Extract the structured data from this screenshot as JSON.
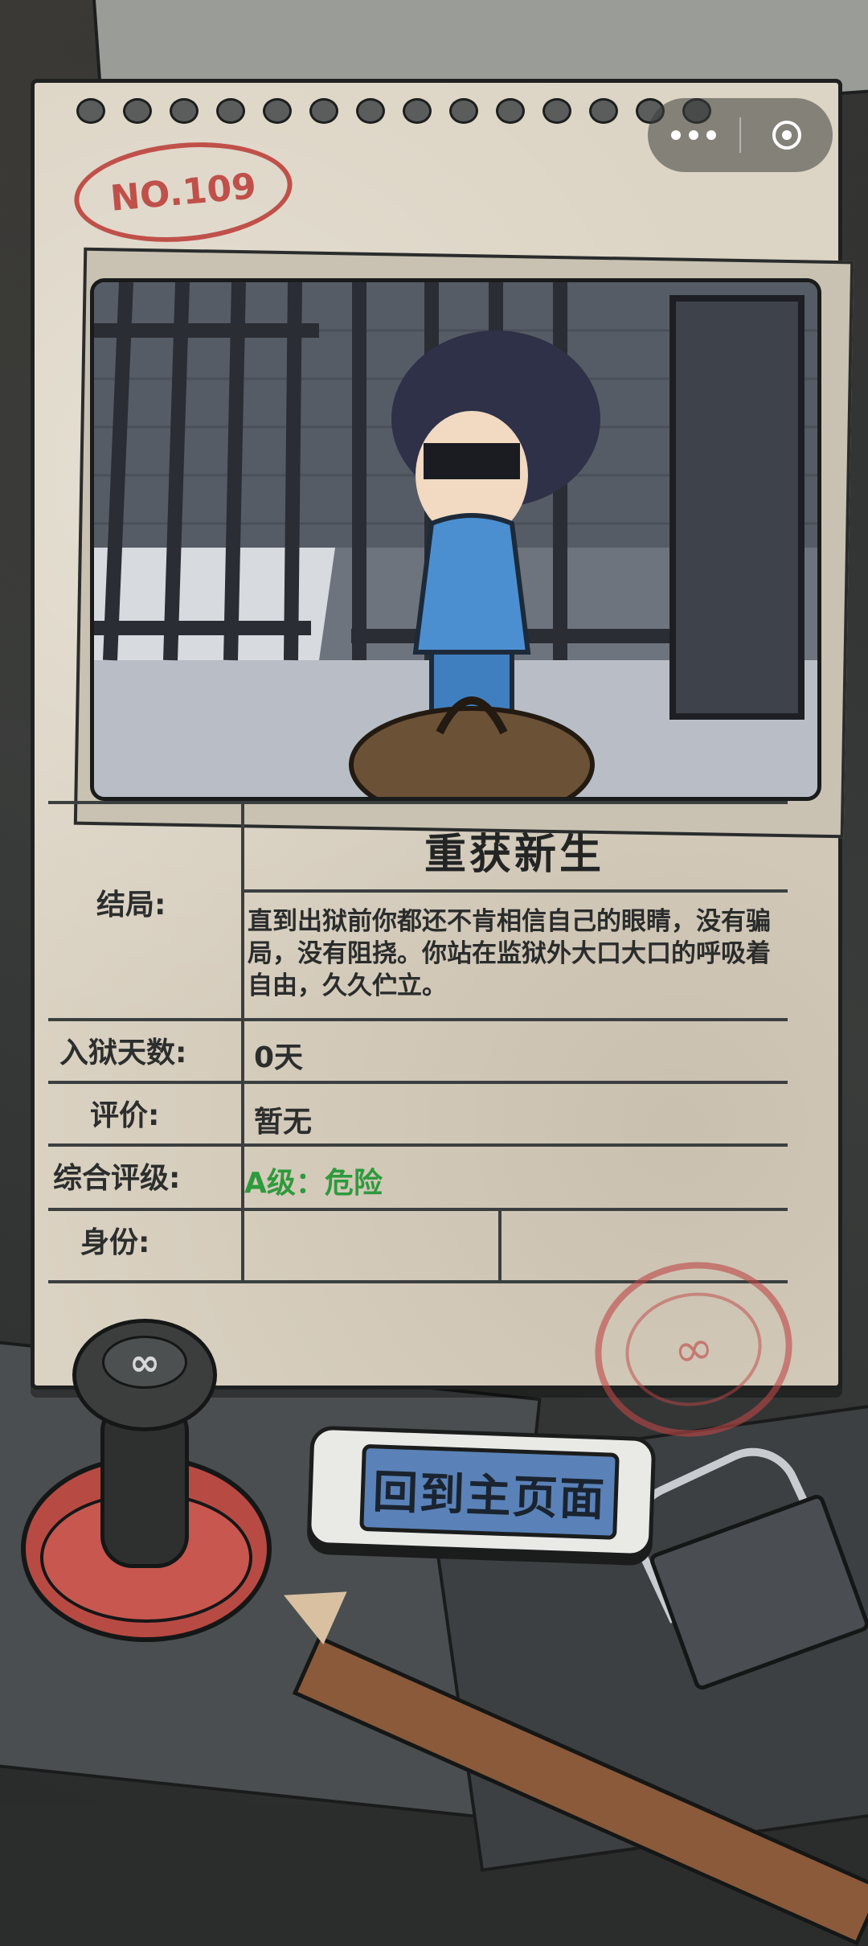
{
  "card": {
    "number": "NO.109",
    "image_alt": "prisoner-leaving-cell-illustration"
  },
  "menu_capsule": {
    "more_icon": "more-dots-icon",
    "close_icon": "close-circle-icon"
  },
  "ending": {
    "label": "结局:",
    "title": "重获新生",
    "description": "直到出狱前你都还不肯相信自己的眼睛，没有骗局，没有阻挠。你站在监狱外大口大口的呼吸着自由，久久伫立。"
  },
  "days": {
    "label": "入狱天数:",
    "value": "0天"
  },
  "review": {
    "label": "评价:",
    "value": "暂无"
  },
  "overall": {
    "label": "综合评级:",
    "value": "A级：危险",
    "color": "#2e9a3c"
  },
  "identity": {
    "label": "身份:",
    "value": ""
  },
  "home_button": {
    "label": "回到主页面"
  },
  "stamp": {
    "symbol": "∞"
  },
  "seal": {
    "symbol": "∞"
  }
}
